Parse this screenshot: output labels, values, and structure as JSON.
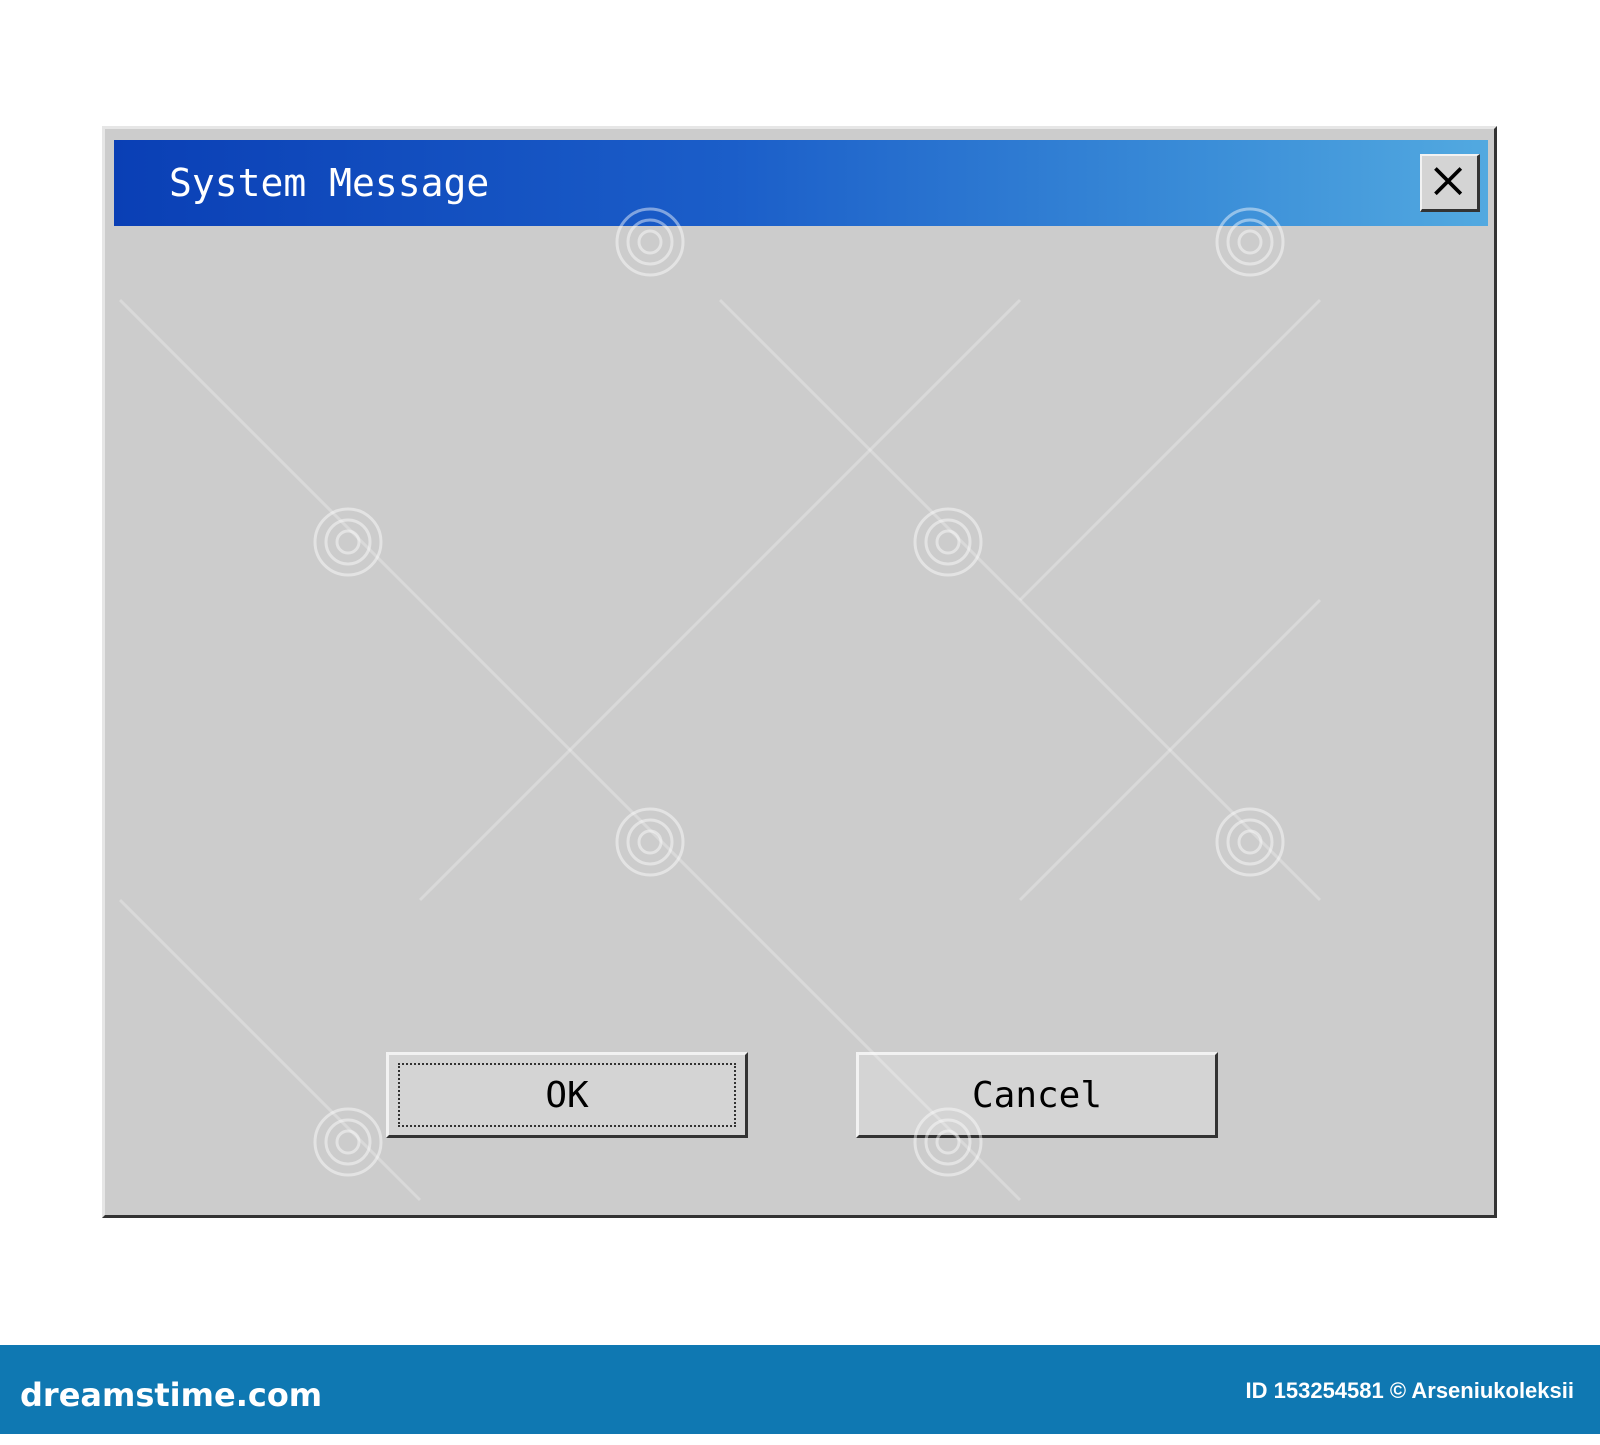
{
  "dialog": {
    "title": "System Message",
    "close_icon": "close-icon",
    "titlebar_gradient": [
      "#0a3fb5",
      "#52a9e0"
    ],
    "background": "#cccccc",
    "buttons": {
      "ok_label": "OK",
      "cancel_label": "Cancel"
    }
  },
  "footer": {
    "logo_text": "dreamstime.com",
    "image_id": "ID 153254581 © Arseniukoleksii",
    "background": "#0f78b2"
  }
}
